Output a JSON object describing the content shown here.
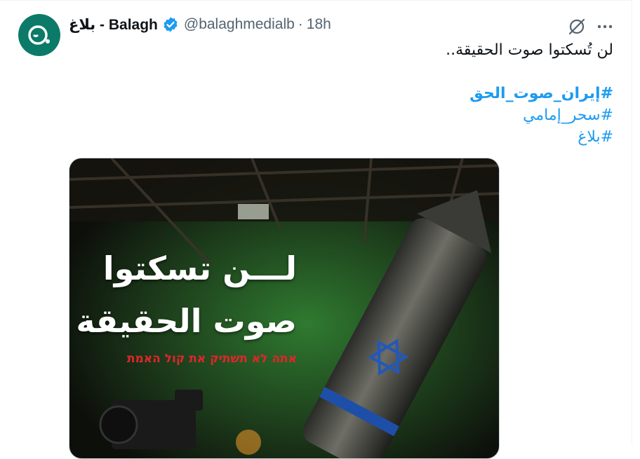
{
  "author": {
    "display_name": "بلاغ - Balagh",
    "handle": "@balaghmedialb",
    "separator": "·",
    "timestamp": "18h"
  },
  "tweet": {
    "text": "لن تُسكتوا صوت الحقيقة..",
    "hashtags": [
      "#إيران_صوت_الحق",
      "#سحر_إمامي",
      "#بلاغ"
    ]
  },
  "media": {
    "headline_1": "لـــن تسكتوا",
    "headline_2": "صوت الحقيقة",
    "subline": "אתה לא תשתיק את קול האמת"
  },
  "colors": {
    "link": "#1d9bf0",
    "avatar_bg": "#0c7a68",
    "verified": "#1d9bf0",
    "secondary_text": "#536471",
    "subline_red": "#e0262b"
  },
  "icons": [
    "grok-icon",
    "more-icon",
    "verified-icon"
  ]
}
